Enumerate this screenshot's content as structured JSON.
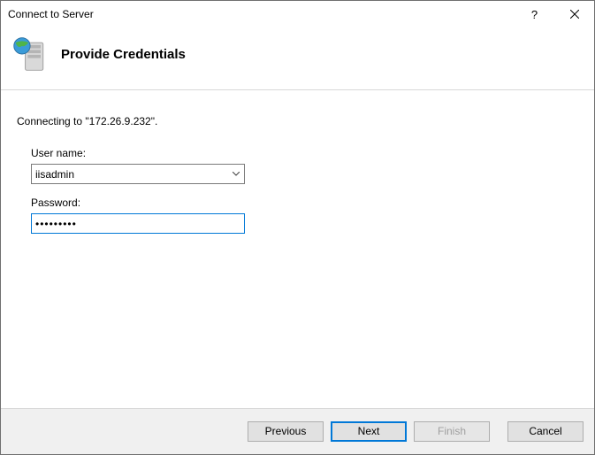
{
  "window": {
    "title": "Connect to Server"
  },
  "header": {
    "title": "Provide Credentials"
  },
  "content": {
    "connecting_to": "Connecting to \"172.26.9.232\".",
    "username_label": "User name:",
    "username_value": "iisadmin",
    "password_label": "Password:",
    "password_value": "•••••••••"
  },
  "buttons": {
    "previous": "Previous",
    "next": "Next",
    "finish": "Finish",
    "cancel": "Cancel"
  }
}
